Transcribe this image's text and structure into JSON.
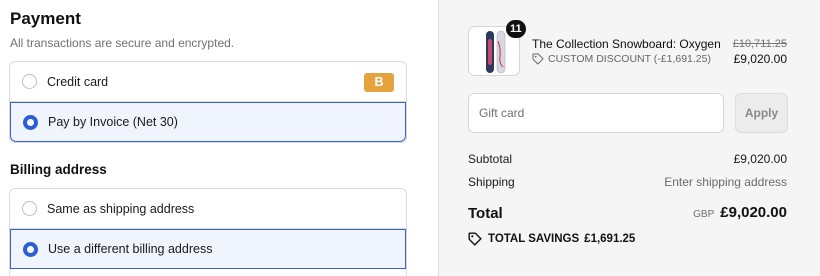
{
  "payment": {
    "title": "Payment",
    "subtitle": "All transactions are secure and encrypted.",
    "methods": [
      {
        "label": "Credit card",
        "badge": "B",
        "selected": false
      },
      {
        "label": "Pay by Invoice (Net 30)",
        "selected": true
      }
    ]
  },
  "billing": {
    "title": "Billing address",
    "options": [
      {
        "label": "Same as shipping address",
        "selected": false
      },
      {
        "label": "Use a different billing address",
        "selected": true
      }
    ]
  },
  "summary": {
    "item": {
      "quantity": "11",
      "name": "The Collection Snowboard: Oxygen",
      "discount": "CUSTOM DISCOUNT (-£1,691.25)",
      "original_price": "£10,711.25",
      "price": "£9,020.00"
    },
    "gift_card": {
      "placeholder": "Gift card",
      "apply_label": "Apply"
    },
    "subtotal": {
      "label": "Subtotal",
      "value": "£9,020.00"
    },
    "shipping": {
      "label": "Shipping",
      "value": "Enter shipping address"
    },
    "total": {
      "label": "Total",
      "currency": "GBP",
      "value": "£9,020.00"
    },
    "savings": {
      "label": "TOTAL SAVINGS",
      "value": "£1,691.25"
    }
  },
  "colors": {
    "accent": "#2b5fd6",
    "selected_bg": "#f0f4fc",
    "badge": "#e6a33d",
    "summary_bg": "#f5f5f5"
  }
}
